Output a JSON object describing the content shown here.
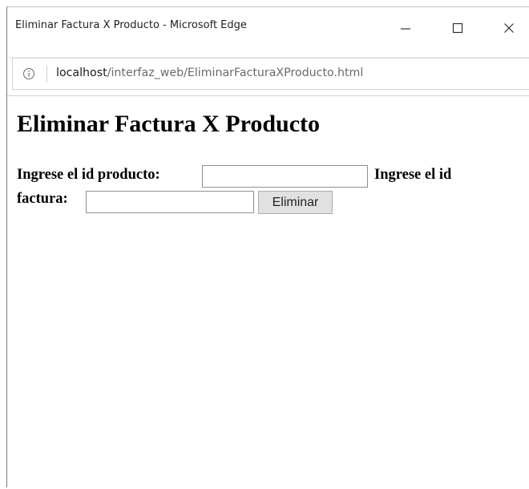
{
  "window": {
    "title": "Eliminar Factura X Producto - Microsoft Edge"
  },
  "addressbar": {
    "url_host": "localhost",
    "url_path": "/interfaz_web/EliminarFacturaXProducto.html"
  },
  "page": {
    "heading": "Eliminar Factura X Producto",
    "producto_label": "Ingrese el id producto:",
    "producto_value": "",
    "factura_label_part1": "Ingrese el id",
    "factura_label_part2": "factura:",
    "factura_value": "",
    "submit_label": "Eliminar"
  },
  "icons": {
    "info": "info-icon",
    "minimize": "minimize-icon",
    "maximize": "maximize-icon",
    "close": "close-icon"
  }
}
